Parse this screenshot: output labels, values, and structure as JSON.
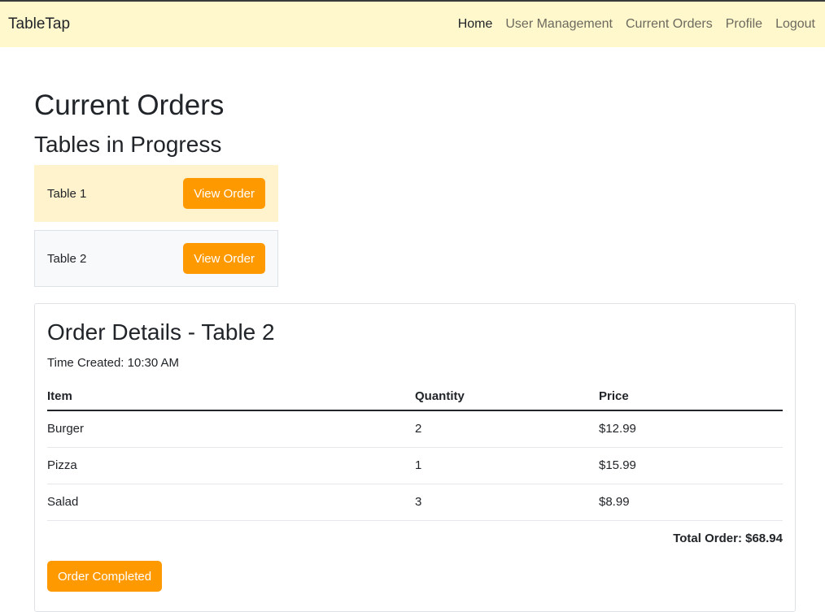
{
  "nav": {
    "brand": "TableTap",
    "links": [
      "Home",
      "User Management",
      "Current Orders",
      "Profile",
      "Logout"
    ]
  },
  "page": {
    "title": "Current Orders",
    "section_title": "Tables in Progress"
  },
  "tables": [
    {
      "name": "Table 1",
      "button": "View Order"
    },
    {
      "name": "Table 2",
      "button": "View Order"
    }
  ],
  "order": {
    "title": "Order Details - Table 2",
    "time_created": "Time Created: 10:30 AM",
    "columns": [
      "Item",
      "Quantity",
      "Price"
    ],
    "rows": [
      {
        "item": "Burger",
        "quantity": "2",
        "price": "$12.99"
      },
      {
        "item": "Pizza",
        "quantity": "1",
        "price": "$15.99"
      },
      {
        "item": "Salad",
        "quantity": "3",
        "price": "$8.99"
      }
    ],
    "total": "Total Order: $68.94",
    "complete_button": "Order Completed"
  },
  "colors": {
    "navbar_bg": "#fff8cc",
    "accent": "#ff9900",
    "selected_card_bg": "#fff3cd"
  }
}
